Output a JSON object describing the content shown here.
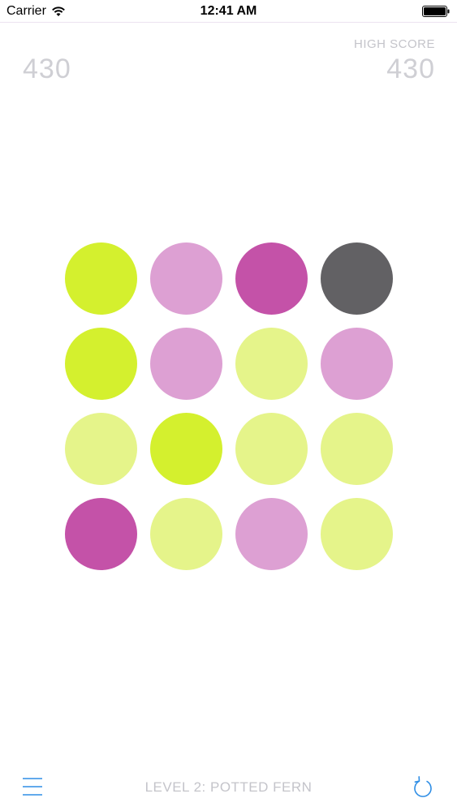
{
  "status_bar": {
    "carrier": "Carrier",
    "time": "12:41 AM",
    "wifi_icon": "wifi-icon",
    "battery_icon": "battery-icon"
  },
  "score": {
    "value": "430"
  },
  "high_score": {
    "label": "HIGH SCORE",
    "value": "430"
  },
  "level": {
    "label": "LEVEL 2: POTTED FERN"
  },
  "toolbar": {
    "menu_icon": "menu-icon",
    "restart_icon": "restart-icon"
  },
  "colors": {
    "lime": "#d4f02e",
    "pale_lime": "#e5f48a",
    "pink": "#dda0d3",
    "magenta": "#c452a8",
    "gray": "#626164",
    "accent_blue": "#2f8ee5",
    "label_gray": "#c4c4ca"
  },
  "board": {
    "rows": 4,
    "cols": 4,
    "cells": [
      [
        "lime",
        "pink",
        "magenta",
        "gray"
      ],
      [
        "lime",
        "pink",
        "pale_lime",
        "pink"
      ],
      [
        "pale_lime",
        "lime",
        "pale_lime",
        "pale_lime"
      ],
      [
        "magenta",
        "pale_lime",
        "pink",
        "pale_lime"
      ]
    ]
  }
}
